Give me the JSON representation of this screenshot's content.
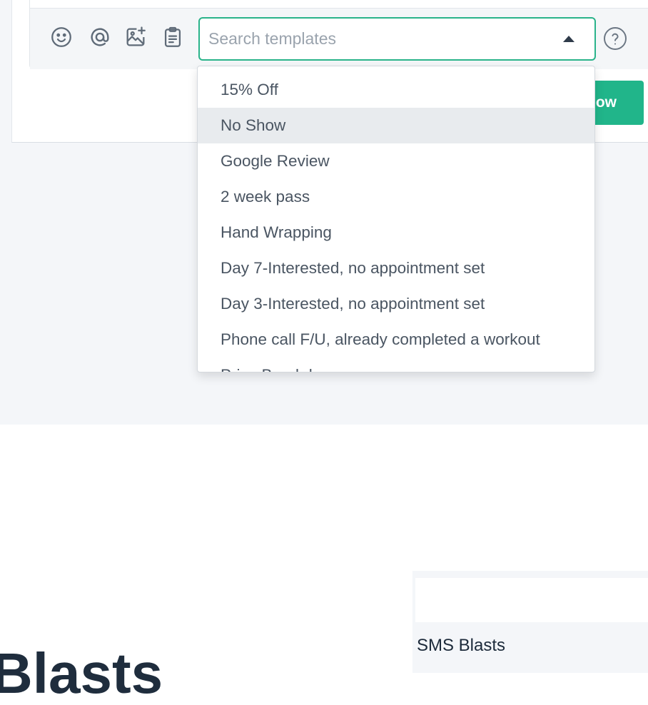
{
  "composer": {
    "search": {
      "placeholder": "Search templates",
      "value": ""
    },
    "toolbar_icons": [
      "smile-icon",
      "at-sign-icon",
      "add-image-icon",
      "clipboard-icon"
    ],
    "help_icon": "question-circle-icon",
    "green_button_label": "ow"
  },
  "templates_dropdown": {
    "options": [
      "15% Off",
      "No Show",
      "Google Review",
      "2 week pass",
      "Hand Wrapping",
      "Day 7-Interested, no appointment set",
      "Day 3-Interested, no appointment set",
      "Phone call F/U, already completed a workout",
      "Price Breakdown"
    ],
    "highlighted": "No Show"
  },
  "bottom": {
    "heading": "Blasts",
    "side_label": "SMS Blasts"
  },
  "colors": {
    "accent": "#21b58a",
    "focus_border": "#2ab38a",
    "page_bg": "#f4f6f9",
    "heading_text": "#1f2d3d"
  }
}
